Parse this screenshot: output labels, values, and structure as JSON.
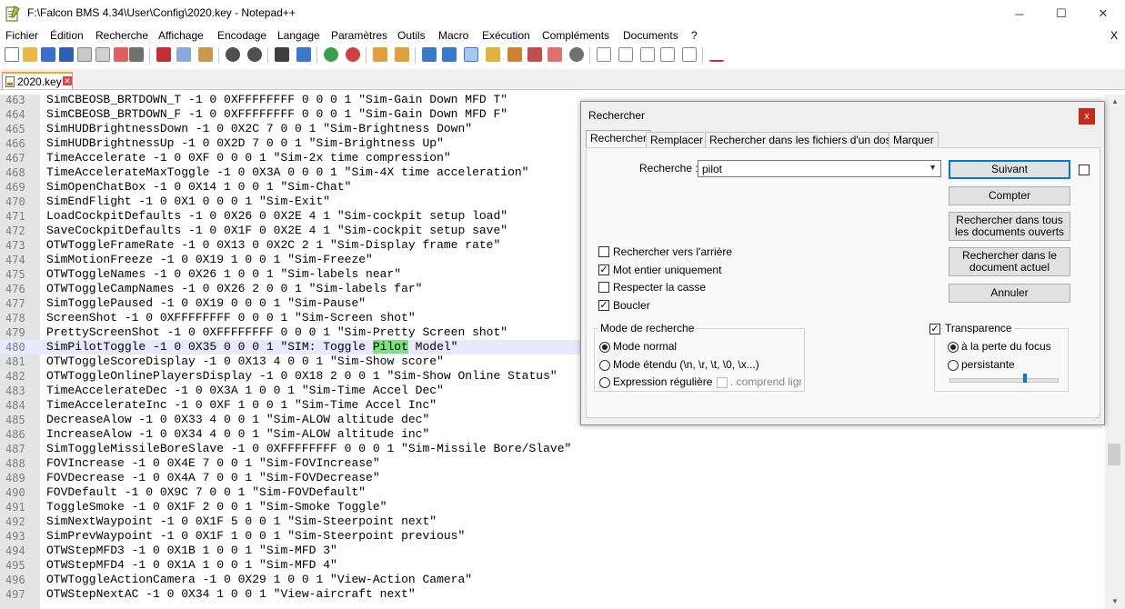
{
  "window": {
    "title": "F:\\Falcon BMS 4.34\\User\\Config\\2020.key - Notepad++",
    "minimize": "─",
    "maximize": "☐",
    "close": "✕"
  },
  "menu": {
    "items": [
      "Fichier",
      "Édition",
      "Recherche",
      "Affichage",
      "Encodage",
      "Langage",
      "Paramètres",
      "Outils",
      "Macro",
      "Exécution",
      "Compléments",
      "Documents",
      "?"
    ],
    "close": "X"
  },
  "tab": {
    "label": "2020.key",
    "close": "✕"
  },
  "editor": {
    "lines": [
      {
        "n": "463",
        "pre": "SimCBEOSB_BRTDOWN_T -1 0 0XFFFFFFFF 0 0 0 1 \"Sim-Gain Down MFD T\"",
        "hl": "",
        "post": ""
      },
      {
        "n": "464",
        "pre": "SimCBEOSB_BRTDOWN_F -1 0 0XFFFFFFFF 0 0 0 1 \"Sim-Gain Down MFD F\"",
        "hl": "",
        "post": ""
      },
      {
        "n": "465",
        "pre": "SimHUDBrightnessDown -1 0 0X2C 7 0 0 1 \"Sim-Brightness Down\"",
        "hl": "",
        "post": ""
      },
      {
        "n": "466",
        "pre": "SimHUDBrightnessUp -1 0 0X2D 7 0 0 1 \"Sim-Brightness Up\"",
        "hl": "",
        "post": ""
      },
      {
        "n": "467",
        "pre": "TimeAccelerate -1 0 0XF 0 0 0 1 \"Sim-2x time compression\"",
        "hl": "",
        "post": ""
      },
      {
        "n": "468",
        "pre": "TimeAccelerateMaxToggle -1 0 0X3A 0 0 0 1 \"Sim-4X time acceleration\"",
        "hl": "",
        "post": ""
      },
      {
        "n": "469",
        "pre": "SimOpenChatBox -1 0 0X14 1 0 0 1 \"Sim-Chat\"",
        "hl": "",
        "post": ""
      },
      {
        "n": "470",
        "pre": "SimEndFlight -1 0 0X1 0 0 0 1 \"Sim-Exit\"",
        "hl": "",
        "post": ""
      },
      {
        "n": "471",
        "pre": "LoadCockpitDefaults -1 0 0X26 0 0X2E 4 1 \"Sim-cockpit setup load\"",
        "hl": "",
        "post": ""
      },
      {
        "n": "472",
        "pre": "SaveCockpitDefaults -1 0 0X1F 0 0X2E 4 1 \"Sim-cockpit setup save\"",
        "hl": "",
        "post": ""
      },
      {
        "n": "473",
        "pre": "OTWToggleFrameRate -1 0 0X13 0 0X2C 2 1 \"Sim-Display frame rate\"",
        "hl": "",
        "post": ""
      },
      {
        "n": "474",
        "pre": "SimMotionFreeze -1 0 0X19 1 0 0 1 \"Sim-Freeze\"",
        "hl": "",
        "post": ""
      },
      {
        "n": "475",
        "pre": "OTWToggleNames -1 0 0X26 1 0 0 1 \"Sim-labels near\"",
        "hl": "",
        "post": ""
      },
      {
        "n": "476",
        "pre": "OTWToggleCampNames -1 0 0X26 2 0 0 1 \"Sim-labels far\"",
        "hl": "",
        "post": ""
      },
      {
        "n": "477",
        "pre": "SimTogglePaused -1 0 0X19 0 0 0 1 \"Sim-Pause\"",
        "hl": "",
        "post": ""
      },
      {
        "n": "478",
        "pre": "ScreenShot -1 0 0XFFFFFFFF 0 0 0 1 \"Sim-Screen shot\"",
        "hl": "",
        "post": ""
      },
      {
        "n": "479",
        "pre": "PrettyScreenShot -1 0 0XFFFFFFFF 0 0 0 1 \"Sim-Pretty Screen shot\"",
        "hl": "",
        "post": ""
      },
      {
        "n": "480",
        "pre": "SimPilotToggle -1 0 0X35 0 0 0 1 \"SIM: Toggle ",
        "hl": "Pilot",
        "post": " Model\""
      },
      {
        "n": "481",
        "pre": "OTWToggleScoreDisplay -1 0 0X13 4 0 0 1 \"Sim-Show score\"",
        "hl": "",
        "post": ""
      },
      {
        "n": "482",
        "pre": "OTWToggleOnlinePlayersDisplay -1 0 0X18 2 0 0 1 \"Sim-Show Online Status\"",
        "hl": "",
        "post": ""
      },
      {
        "n": "483",
        "pre": "TimeAccelerateDec -1 0 0X3A 1 0 0 1 \"Sim-Time Accel Dec\"",
        "hl": "",
        "post": ""
      },
      {
        "n": "484",
        "pre": "TimeAccelerateInc -1 0 0XF 1 0 0 1 \"Sim-Time Accel Inc\"",
        "hl": "",
        "post": ""
      },
      {
        "n": "485",
        "pre": "DecreaseAlow -1 0 0X33 4 0 0 1 \"Sim-ALOW altitude dec\"",
        "hl": "",
        "post": ""
      },
      {
        "n": "486",
        "pre": "IncreaseAlow -1 0 0X34 4 0 0 1 \"Sim-ALOW altitude inc\"",
        "hl": "",
        "post": ""
      },
      {
        "n": "487",
        "pre": "SimToggleMissileBoreSlave -1 0 0XFFFFFFFF 0 0 0 1 \"Sim-Missile Bore/Slave\"",
        "hl": "",
        "post": ""
      },
      {
        "n": "488",
        "pre": "FOVIncrease -1 0 0X4E 7 0 0 1 \"Sim-FOVIncrease\"",
        "hl": "",
        "post": ""
      },
      {
        "n": "489",
        "pre": "FOVDecrease -1 0 0X4A 7 0 0 1 \"Sim-FOVDecrease\"",
        "hl": "",
        "post": ""
      },
      {
        "n": "490",
        "pre": "FOVDefault -1 0 0X9C 7 0 0 1 \"Sim-FOVDefault\"",
        "hl": "",
        "post": ""
      },
      {
        "n": "491",
        "pre": "ToggleSmoke -1 0 0X1F 2 0 0 1 \"Sim-Smoke Toggle\"",
        "hl": "",
        "post": ""
      },
      {
        "n": "492",
        "pre": "SimNextWaypoint -1 0 0X1F 5 0 0 1 \"Sim-Steerpoint next\"",
        "hl": "",
        "post": ""
      },
      {
        "n": "493",
        "pre": "SimPrevWaypoint -1 0 0X1F 1 0 0 1 \"Sim-Steerpoint previous\"",
        "hl": "",
        "post": ""
      },
      {
        "n": "494",
        "pre": "OTWStepMFD3 -1 0 0X1B 1 0 0 1 \"Sim-MFD 3\"",
        "hl": "",
        "post": ""
      },
      {
        "n": "495",
        "pre": "OTWStepMFD4 -1 0 0X1A 1 0 0 1 \"Sim-MFD 4\"",
        "hl": "",
        "post": ""
      },
      {
        "n": "496",
        "pre": "OTWToggleActionCamera -1 0 0X29 1 0 0 1 \"View-Action Camera\"",
        "hl": "",
        "post": ""
      },
      {
        "n": "497",
        "pre": "OTWStepNextAC -1 0 0X34 1 0 0 1 \"View-aircraft next\"",
        "hl": "",
        "post": ""
      }
    ]
  },
  "dialog": {
    "title": "Rechercher",
    "close": "x",
    "tabs": [
      "Rechercher",
      "Remplacer",
      "Rechercher dans les fichiers d'un dossier",
      "Marquer"
    ],
    "search_label": "Recherche :",
    "search_value": "pilot",
    "buttons": {
      "next": "Suivant",
      "count": "Compter",
      "find_all_open": "Rechercher dans tous les documents ouverts",
      "find_all_current": "Rechercher dans le document actuel",
      "cancel": "Annuler"
    },
    "options": {
      "backward": "Rechercher vers l'arrière",
      "whole_word": "Mot entier uniquement",
      "match_case": "Respecter la casse",
      "wrap": "Boucler"
    },
    "mode": {
      "title": "Mode de recherche",
      "normal": "Mode normal",
      "extended": "Mode étendu (\\n, \\r, \\t, \\0, \\x...)",
      "regex": "Expression régulière",
      "newline": ". comprend ligne n"
    },
    "transparency": {
      "title": "Transparence",
      "on_lose_focus": "à la perte du focus",
      "always": "persistante",
      "level_percent": 70
    }
  }
}
